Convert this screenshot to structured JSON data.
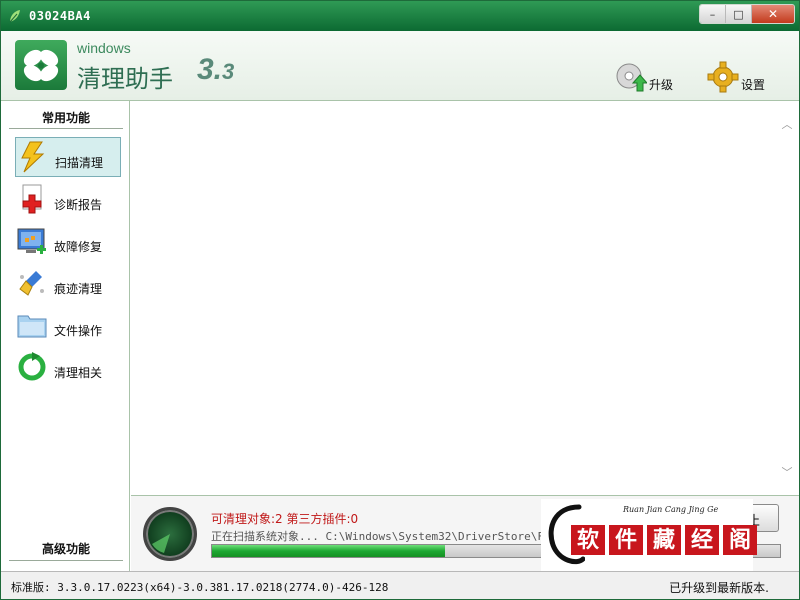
{
  "window": {
    "title": "03024BA4",
    "controls": {
      "minimize": "–",
      "maximize": "□",
      "close": "✕"
    }
  },
  "header": {
    "logo_top": "windows",
    "logo_name": "清理助手",
    "logo_version_major": "3.",
    "logo_version_minor": "3",
    "upgrade_label": "升级",
    "settings_label": "设置"
  },
  "sidebar": {
    "section_title": "常用功能",
    "items": [
      {
        "label": "扫描清理",
        "icon": "lightning-icon"
      },
      {
        "label": "诊断报告",
        "icon": "report-plus-icon"
      },
      {
        "label": "故障修复",
        "icon": "monitor-repair-icon"
      },
      {
        "label": "痕迹清理",
        "icon": "broom-icon"
      },
      {
        "label": "文件操作",
        "icon": "folder-icon"
      },
      {
        "label": "清理相关",
        "icon": "refresh-arrow-icon"
      }
    ],
    "footer_title": "高级功能"
  },
  "scan": {
    "cleanable_label": "可清理对象:",
    "cleanable_count": "2",
    "plugins_label": "第三方插件:",
    "plugins_count": "0",
    "counts_text": "可清理对象:2 第三方插件:0",
    "scanning_text": "正在扫描系统对象... C:\\Windows\\System32\\DriverStore\\Fi",
    "progress": 0.41,
    "stop_label": "止"
  },
  "watermark": {
    "subtitle": "Ruan Jian Cang Jing Ge",
    "chars": [
      "软",
      "件",
      "藏",
      "经",
      "阁"
    ]
  },
  "status": {
    "version": "标准版: 3.3.0.17.0223(x64)-3.0.381.17.0218(2774.0)-426-128",
    "update": "已升级到最新版本."
  },
  "colors": {
    "titlebar": "#0c6a32",
    "accent_green": "#1ea832",
    "count_red": "#c01818",
    "seal_red": "#c8161d"
  }
}
